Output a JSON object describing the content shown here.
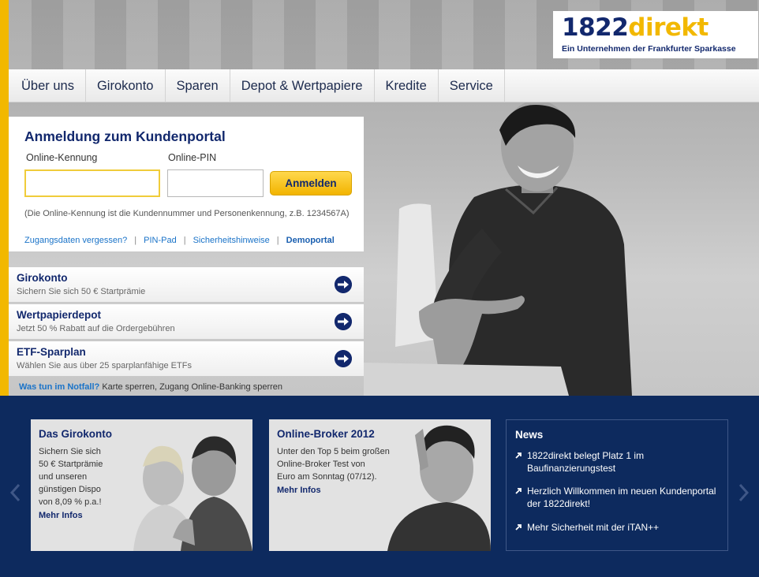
{
  "logo": {
    "brand_number": "1822",
    "brand_word": "direkt",
    "tagline": "Ein Unternehmen der Frankfurter Sparkasse"
  },
  "nav": {
    "items": [
      "Über uns",
      "Girokonto",
      "Sparen",
      "Depot & Wertpapiere",
      "Kredite",
      "Service"
    ]
  },
  "login": {
    "title": "Anmeldung zum Kundenportal",
    "id_label": "Online-Kennung",
    "id_value": "",
    "pin_label": "Online-PIN",
    "pin_value": "",
    "button": "Anmelden",
    "hint": "(Die Online-Kennung ist die Kundennummer und Personenkennung, z.B. 1234567A)",
    "links": [
      "Zugangsdaten vergessen?",
      "PIN-Pad",
      "Sicherheitshinweise",
      "Demoportal"
    ]
  },
  "products": [
    {
      "title": "Girokonto",
      "subtitle": "Sichern Sie sich 50 € Startprämie"
    },
    {
      "title": "Wertpapierdepot",
      "subtitle": "Jetzt 50 % Rabatt auf die Ordergebühren"
    },
    {
      "title": "ETF-Sparplan",
      "subtitle": "Wählen Sie aus über 25 sparplanfähige ETFs"
    }
  ],
  "emergency": {
    "link": "Was tun im Notfall?",
    "text": "Karte sperren, Zugang Online-Banking sperren"
  },
  "teasers": [
    {
      "title": "Das Girokonto",
      "lines": [
        "Sichern Sie sich",
        "50 € Startprämie",
        "und unseren",
        "günstigen Dispo",
        "von 8,09 % p.a.!"
      ],
      "more": "Mehr Infos"
    },
    {
      "title": "Online-Broker 2012",
      "lines": [
        "Unter den Top 5 beim großen",
        "Online-Broker Test von",
        "Euro am Sonntag (07/12)."
      ],
      "more": "Mehr Infos"
    }
  ],
  "news": {
    "title": "News",
    "items": [
      {
        "line1": "1822direkt belegt Platz 1 im",
        "line2": "Baufinanzierungstest"
      },
      {
        "line1": "Herzlich Willkommen im neuen Kundenportal",
        "line2": "der 1822direkt!"
      },
      {
        "line1": "Mehr Sicherheit mit der iTAN++",
        "line2": ""
      }
    ]
  },
  "colors": {
    "brand_blue": "#12286d",
    "brand_yellow": "#f2b800",
    "bottom_bg": "#0d2a5e",
    "link": "#1a73c8"
  },
  "icons": [
    "arrow-right-circle-icon",
    "chevron-left-icon",
    "chevron-right-icon",
    "news-arrow-icon"
  ]
}
